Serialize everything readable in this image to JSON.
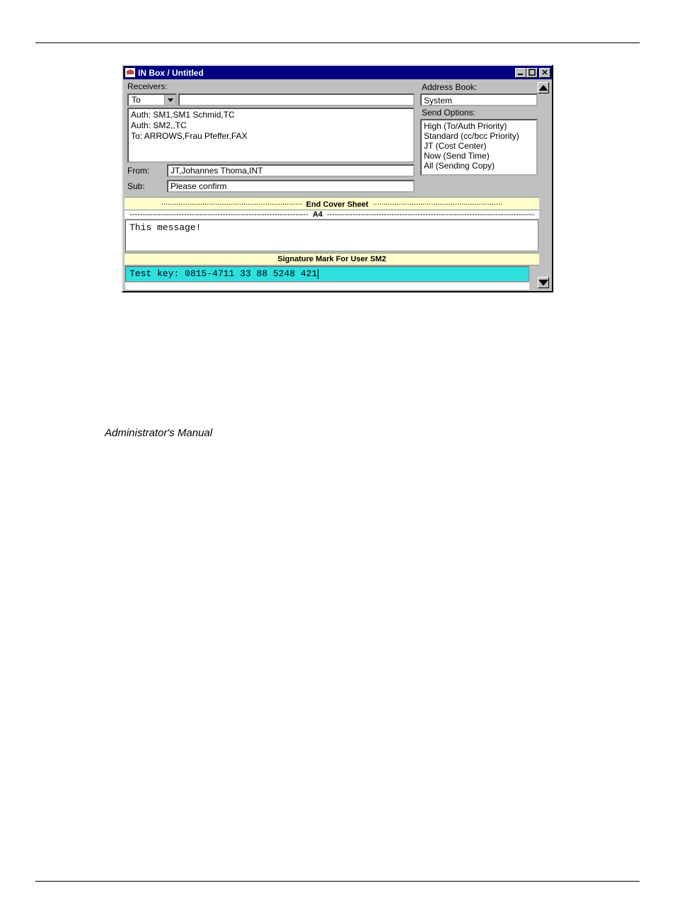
{
  "window": {
    "title": "IN Box / Untitled",
    "icon_name": "inbox-app-icon",
    "min_label": "_",
    "max_label": "□",
    "close_label": "×"
  },
  "left_panel": {
    "receivers_label": "Receivers:",
    "to_combo_value": "To",
    "receivers_lines": [
      "Auth: SM1,SM1 Schmid,TC",
      "Auth: SM2,,TC",
      "To: ARROWS,Frau Pfeffer,FAX"
    ],
    "from_label": "From:",
    "from_value": "JT,Johannes Thoma,INT",
    "sub_label": "Sub:",
    "sub_value": "Please confirm"
  },
  "right_panel": {
    "address_book_label": "Address Book:",
    "address_book_value": "System",
    "send_options_label": "Send Options:",
    "send_options_lines": [
      "High   (To/Auth Priority)",
      "Standard   (cc/bcc Priority)",
      "JT   (Cost Center)",
      "Now   (Send Time)",
      "All   (Sending Copy)"
    ]
  },
  "content": {
    "end_cover_sheet": "End Cover Sheet",
    "a4_label": "A4",
    "message_body": "This message!",
    "signature_band": "Signature Mark For User SM2",
    "test_key": "Test key: 0815-4711 33 88 5248 421"
  },
  "footer": {
    "manual_label": "Administrator's Manual"
  }
}
